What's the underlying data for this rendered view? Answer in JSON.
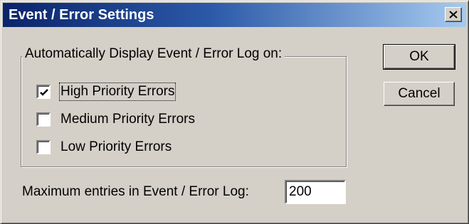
{
  "window": {
    "title": "Event / Error Settings",
    "close_icon": "close-icon"
  },
  "group": {
    "legend": "Automatically Display Event / Error Log on:",
    "options": [
      {
        "label": "High Priority Errors",
        "checked": true
      },
      {
        "label": "Medium Priority Errors",
        "checked": false
      },
      {
        "label": "Low Priority Errors",
        "checked": false
      }
    ]
  },
  "buttons": {
    "ok_label": "OK",
    "cancel_label": "Cancel"
  },
  "max_entries": {
    "label": "Maximum entries in Event / Error Log:",
    "value": "200"
  },
  "colors": {
    "face": "#d4d0c8",
    "title_start": "#0a246a",
    "title_end": "#a6caf0"
  }
}
